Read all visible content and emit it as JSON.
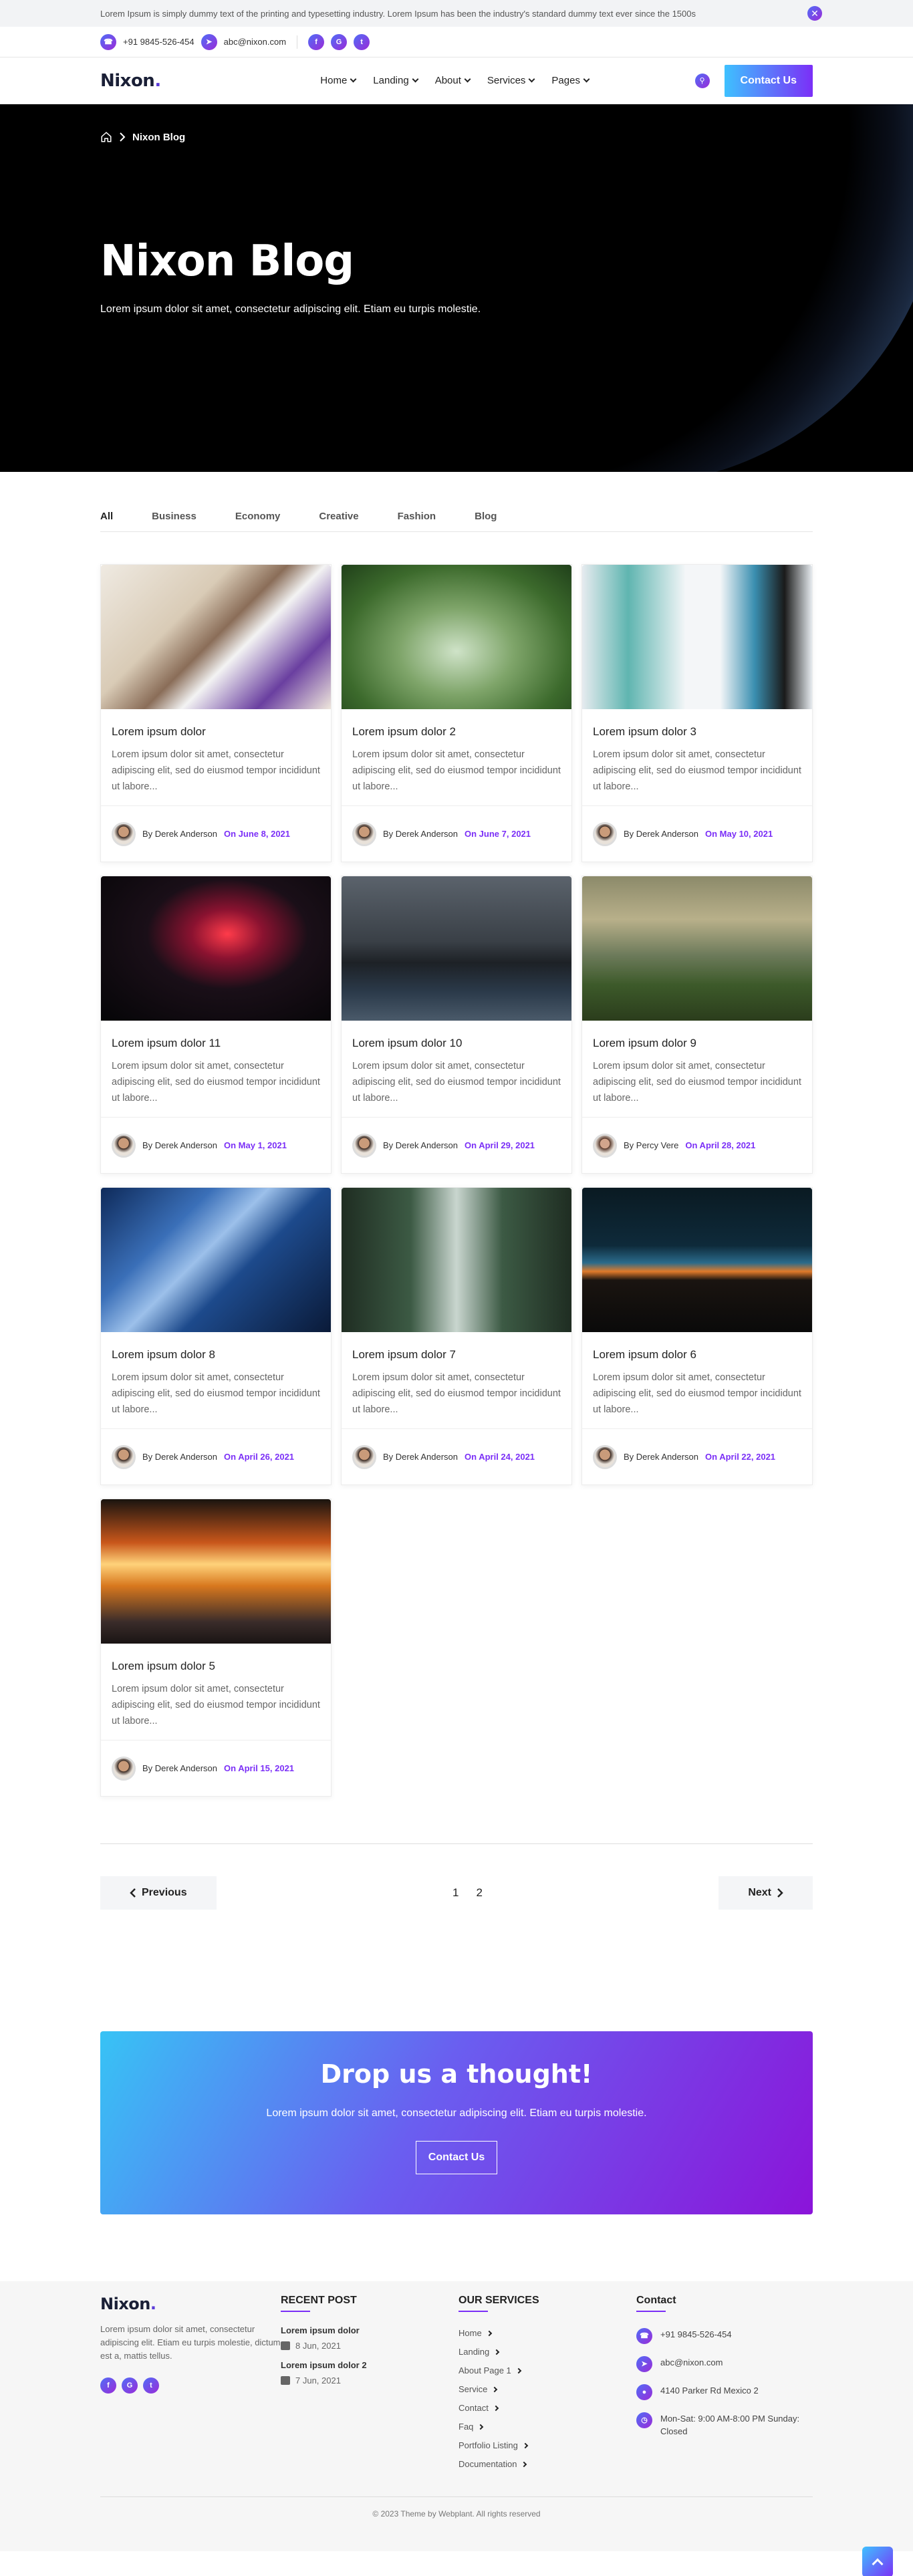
{
  "notice": {
    "text": "Lorem Ipsum is simply dummy text of the printing and typesetting industry. Lorem Ipsum has been the industry's standard dummy text ever since the 1500s",
    "close": "✕"
  },
  "contact": {
    "phone": "+91 9845-526-454",
    "email": "abc@nixon.com",
    "social": [
      "f",
      "G",
      "t"
    ]
  },
  "nav": {
    "logo": "Nixon",
    "items": [
      "Home",
      "Landing",
      "About",
      "Services",
      "Pages"
    ],
    "cta": "Contact Us"
  },
  "hero": {
    "crumb": "Nixon Blog",
    "title": "Nixon Blog",
    "subtitle": "Lorem ipsum dolor sit amet, consectetur adipiscing elit. Etiam eu turpis molestie."
  },
  "tabs": [
    "All",
    "Business",
    "Economy",
    "Creative",
    "Fashion",
    "Blog"
  ],
  "posts": [
    {
      "title": "Lorem ipsum dolor",
      "excerpt": "Lorem ipsum dolor sit amet, consectetur adipiscing elit, sed do eiusmod tempor incididunt ut labore...",
      "author": "By Derek Anderson",
      "date": "On June 8, 2021"
    },
    {
      "title": "Lorem ipsum dolor 2",
      "excerpt": "Lorem ipsum dolor sit amet, consectetur adipiscing elit, sed do eiusmod tempor incididunt ut labore...",
      "author": "By Derek Anderson",
      "date": "On June 7, 2021"
    },
    {
      "title": "Lorem ipsum dolor 3",
      "excerpt": "Lorem ipsum dolor sit amet, consectetur adipiscing elit, sed do eiusmod tempor incididunt ut labore...",
      "author": "By Derek Anderson",
      "date": "On May 10, 2021"
    },
    {
      "title": "Lorem ipsum dolor 11",
      "excerpt": "Lorem ipsum dolor sit amet, consectetur adipiscing elit, sed do eiusmod tempor incididunt ut labore...",
      "author": "By Derek Anderson",
      "date": "On May 1, 2021"
    },
    {
      "title": "Lorem ipsum dolor 10",
      "excerpt": "Lorem ipsum dolor sit amet, consectetur adipiscing elit, sed do eiusmod tempor incididunt ut labore...",
      "author": "By Derek Anderson",
      "date": "On April 29, 2021"
    },
    {
      "title": "Lorem ipsum dolor 9",
      "excerpt": "Lorem ipsum dolor sit amet, consectetur adipiscing elit, sed do eiusmod tempor incididunt ut labore...",
      "author": "By Percy Vere",
      "date": "On April 28, 2021"
    },
    {
      "title": "Lorem ipsum dolor 8",
      "excerpt": "Lorem ipsum dolor sit amet, consectetur adipiscing elit, sed do eiusmod tempor incididunt ut labore...",
      "author": "By Derek Anderson",
      "date": "On April 26, 2021"
    },
    {
      "title": "Lorem ipsum dolor 7",
      "excerpt": "Lorem ipsum dolor sit amet, consectetur adipiscing elit, sed do eiusmod tempor incididunt ut labore...",
      "author": "By Derek Anderson",
      "date": "On April 24, 2021"
    },
    {
      "title": "Lorem ipsum dolor 6",
      "excerpt": "Lorem ipsum dolor sit amet, consectetur adipiscing elit, sed do eiusmod tempor incididunt ut labore...",
      "author": "By Derek Anderson",
      "date": "On April 22, 2021"
    },
    {
      "title": "Lorem ipsum dolor 5",
      "excerpt": "Lorem ipsum dolor sit amet, consectetur adipiscing elit, sed do eiusmod tempor incididunt ut labore...",
      "author": "By Derek Anderson",
      "date": "On April 15, 2021"
    }
  ],
  "pagination": {
    "prev": "Previous",
    "pages": [
      "1",
      "2"
    ],
    "next": "Next"
  },
  "cta": {
    "title": "Drop us a thought!",
    "text": "Lorem ipsum dolor sit amet, consectetur adipiscing elit. Etiam eu turpis molestie.",
    "button": "Contact Us"
  },
  "footer": {
    "about": "Lorem ipsum dolor sit amet, consectetur adipiscing elit. Etiam eu turpis molestie, dictum est a, mattis tellus.",
    "recent_title": "RECENT POST",
    "recent": [
      {
        "title": "Lorem ipsum dolor",
        "date": "8 Jun, 2021"
      },
      {
        "title": "Lorem ipsum dolor 2",
        "date": "7 Jun, 2021"
      }
    ],
    "services_title": "OUR SERVICES",
    "services": [
      "Home",
      "Landing",
      "About Page 1",
      "Service",
      "Contact",
      "Faq",
      "Portfolio Listing",
      "Documentation"
    ],
    "contact_title": "Contact",
    "contact": [
      "+91 9845-526-454",
      "abc@nixon.com",
      "4140 Parker Rd Mexico 2",
      "Mon-Sat: 9:00 AM-8:00 PM Sunday: Closed"
    ],
    "copyright": "© 2023 Theme by Webplant. All rights reserved"
  },
  "colors": {
    "accent": "#7b2ff7",
    "gradient_start": "#3ec1ff",
    "gradient_end": "#7b2ff7"
  }
}
